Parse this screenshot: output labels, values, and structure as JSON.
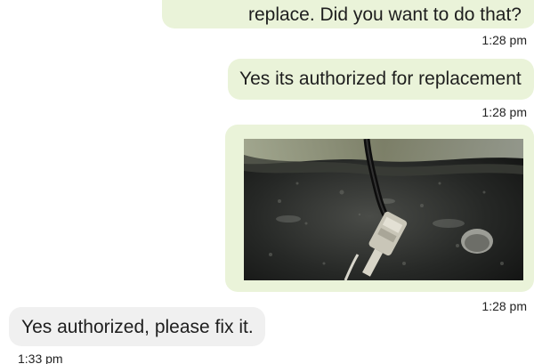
{
  "messages": [
    {
      "direction": "outgoing",
      "text": "replace. Did you want to do that?",
      "time": "1:28 pm"
    },
    {
      "direction": "outgoing",
      "text": "Yes its authorized for replacement",
      "time": "1:28 pm"
    },
    {
      "direction": "outgoing",
      "type": "image",
      "image_subject": "engine-bay-wiring-connector-photo",
      "time": "1:28 pm"
    },
    {
      "direction": "incoming",
      "text": "Yes authorized, please fix it.",
      "time": "1:33 pm"
    }
  ],
  "colors": {
    "outgoing_bubble": "#eaf3d9",
    "incoming_bubble": "#f0f0f0",
    "text": "#1e1e1e"
  }
}
